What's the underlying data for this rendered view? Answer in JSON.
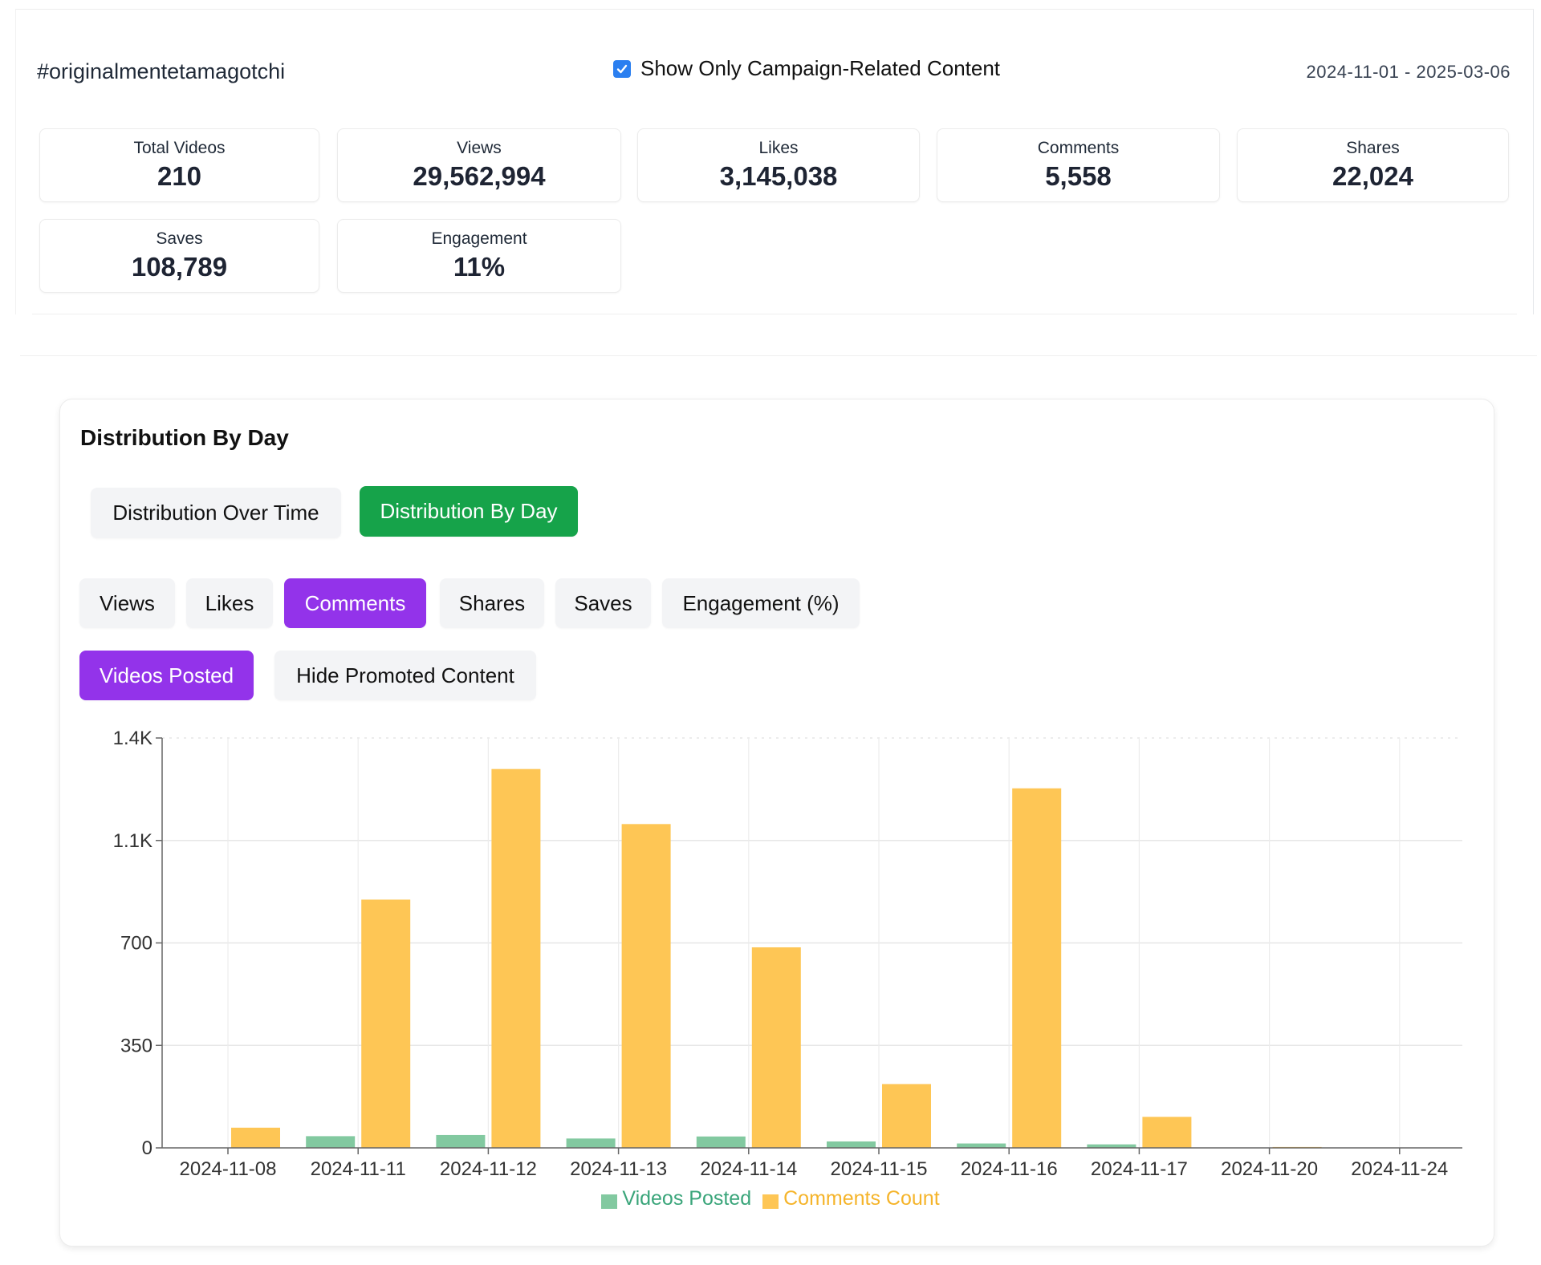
{
  "header": {
    "hashtag": "#originalmentetamagotchi",
    "campaign_filter": {
      "label": "Show Only Campaign-Related Content",
      "checked": true
    },
    "date_range": "2024-11-01 - 2025-03-06"
  },
  "stats": [
    {
      "label": "Total Videos",
      "value": "210"
    },
    {
      "label": "Views",
      "value": "29,562,994"
    },
    {
      "label": "Likes",
      "value": "3,145,038"
    },
    {
      "label": "Comments",
      "value": "5,558"
    },
    {
      "label": "Shares",
      "value": "22,024"
    },
    {
      "label": "Saves",
      "value": "108,789"
    },
    {
      "label": "Engagement",
      "value": "11%"
    }
  ],
  "panel": {
    "title": "Distribution By Day",
    "view_tabs": [
      {
        "label": "Distribution Over Time",
        "active": false
      },
      {
        "label": "Distribution By Day",
        "active": true
      }
    ],
    "metric_tabs": [
      {
        "label": "Views",
        "active": false
      },
      {
        "label": "Likes",
        "active": false
      },
      {
        "label": "Comments",
        "active": true
      },
      {
        "label": "Shares",
        "active": false
      },
      {
        "label": "Saves",
        "active": false
      },
      {
        "label": "Engagement (%)",
        "active": false
      }
    ],
    "toggles": [
      {
        "label": "Videos Posted",
        "active": true
      },
      {
        "label": "Hide Promoted Content",
        "active": false
      }
    ]
  },
  "colors": {
    "videos_posted": "#82c9a0",
    "comments_count": "#fec655",
    "videos_posted_text": "#3aa57a",
    "comments_count_text": "#f5b42a",
    "accent_green": "#16a34a",
    "accent_purple": "#9333ea",
    "checkbox": "#2b7ff0"
  },
  "chart_data": {
    "type": "bar",
    "title": "",
    "xlabel": "",
    "ylabel": "",
    "categories": [
      "2024-11-08",
      "2024-11-11",
      "2024-11-12",
      "2024-11-13",
      "2024-11-14",
      "2024-11-15",
      "2024-11-16",
      "2024-11-17",
      "2024-11-20",
      "2024-11-24"
    ],
    "series": [
      {
        "name": "Videos Posted",
        "values": [
          0,
          40,
          44,
          32,
          39,
          22,
          15,
          12,
          0,
          0
        ]
      },
      {
        "name": "Comments Count",
        "values": [
          69,
          848,
          1294,
          1106,
          685,
          218,
          1228,
          106,
          3,
          0
        ]
      }
    ],
    "ylim": [
      0,
      1400
    ],
    "yticks": [
      0,
      350,
      700,
      1050,
      1400
    ],
    "ytick_labels": [
      "0",
      "350",
      "700",
      "1.1K",
      "1.4K"
    ],
    "grid": true,
    "legend": "bottom-center"
  }
}
